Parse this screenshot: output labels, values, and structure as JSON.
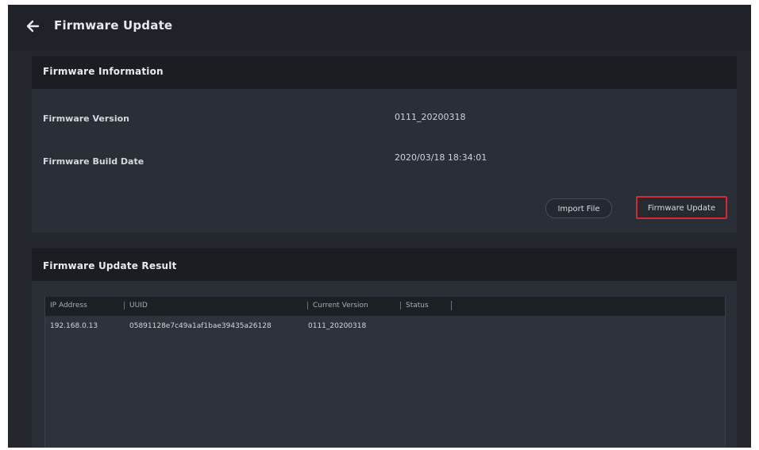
{
  "header": {
    "back_icon": "arrow-left-icon",
    "title": "Firmware Update"
  },
  "firmware_info": {
    "title": "Firmware Information",
    "version_label": "Firmware Version",
    "version_value": "0111_20200318",
    "build_date_label": "Firmware Build Date",
    "build_date_value": "2020/03/18 18:34:01",
    "import_button": "Import File",
    "update_button": "Firmware Update",
    "highlight_color": "#d52a32"
  },
  "update_result": {
    "title": "Firmware Update Result",
    "columns": [
      "IP Address",
      "UUID",
      "Current Version",
      "Status"
    ],
    "rows": [
      {
        "ip": "192.168.0.13",
        "uuid": "05891128e7c49a1af1bae39435a26128",
        "current_version": "0111_20200318",
        "status": ""
      }
    ]
  }
}
